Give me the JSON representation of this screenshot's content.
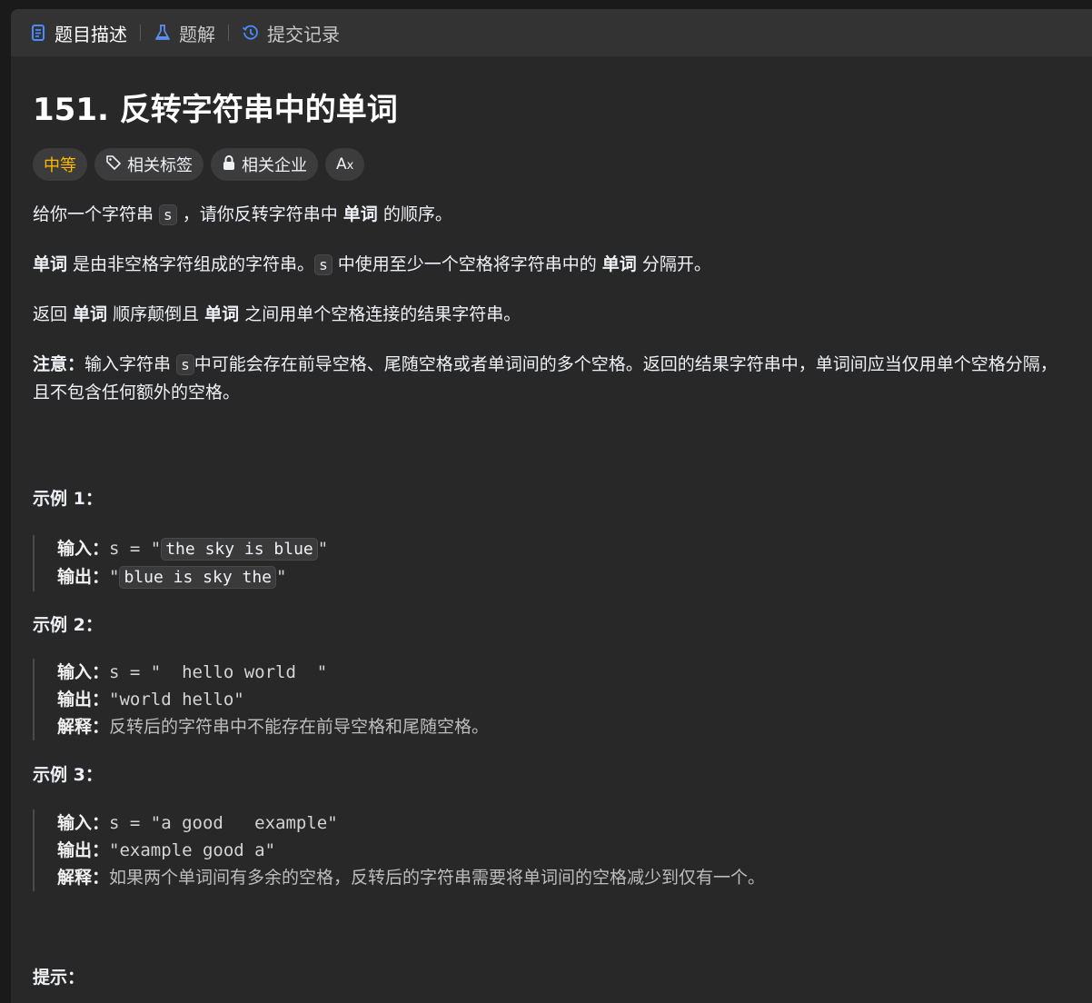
{
  "tabs": [
    {
      "label": "题目描述",
      "icon": "document-icon"
    },
    {
      "label": "题解",
      "icon": "flask-icon"
    },
    {
      "label": "提交记录",
      "icon": "history-icon"
    }
  ],
  "title": "151. 反转字符串中的单词",
  "tags": {
    "difficulty": "中等",
    "topics": "相关标签",
    "companies": "相关企业",
    "translate_icon": "Aあ"
  },
  "description": {
    "p1_pre": "给你一个字符串 ",
    "p1_code": "s",
    "p1_mid": " ，请你反转字符串中 ",
    "p1_bold": "单词",
    "p1_post": " 的顺序。",
    "p2_bold1": "单词",
    "p2_a": " 是由非空格字符组成的字符串。",
    "p2_code": "s",
    "p2_b": " 中使用至少一个空格将字符串中的 ",
    "p2_bold2": "单词",
    "p2_c": " 分隔开。",
    "p3_a": "返回 ",
    "p3_bold1": "单词",
    "p3_b": " 顺序颠倒且 ",
    "p3_bold2": "单词",
    "p3_c": " 之间用单个空格连接的结果字符串。",
    "p4_bold": "注意：",
    "p4_a": "输入字符串 ",
    "p4_code": "s",
    "p4_b": "中可能会存在前导空格、尾随空格或者单词间的多个空格。返回的结果字符串中，单词间应当仅用单个空格分隔，且不包含任何额外的空格。"
  },
  "examples": [
    {
      "heading": "示例 1：",
      "input_label": "输入：",
      "input_prefix": "s = \"",
      "input_code": "the sky is blue",
      "input_suffix": "\"",
      "output_label": "输出：",
      "output_prefix": "\"",
      "output_code": "blue is sky the",
      "output_suffix": "\""
    },
    {
      "heading": "示例 2：",
      "input_label": "输入：",
      "input_value": "s = \"  hello world  \"",
      "output_label": "输出：",
      "output_value": "\"world hello\"",
      "explain_label": "解释：",
      "explain_value": "反转后的字符串中不能存在前导空格和尾随空格。"
    },
    {
      "heading": "示例 3：",
      "input_label": "输入：",
      "input_value": "s = \"a good   example\"",
      "output_label": "输出：",
      "output_value": "\"example good a\"",
      "explain_label": "解释：",
      "explain_value": "如果两个单词间有多余的空格，反转后的字符串需要将单词间的空格减少到仅有一个。"
    }
  ],
  "hints_heading": "提示："
}
